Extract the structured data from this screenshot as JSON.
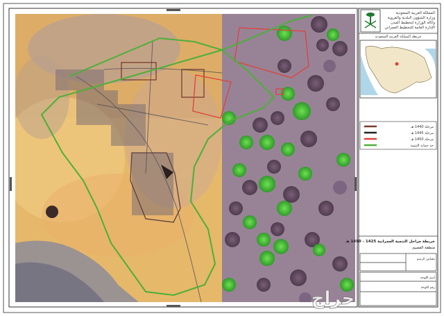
{
  "sheet": {
    "title_block": {
      "emblem": "saudi-emblem",
      "org_lines": [
        "المملكة العربية السعودية",
        "وزارة الشؤون البلدية والقروية",
        "وكالة الوزارة لتخطيط المدن",
        "الإدارة العامة للتخطيط العمراني"
      ],
      "inset_caption": "خريطة المملكة العربية السعودية",
      "map_title": "خريطة مراحل التنمية العمرانية 1425 - 1450 هـ",
      "map_subtitle": "منطقة القصيم",
      "footer_labels": [
        "مقياس الرسم",
        "اسم اللوحة",
        "رقم اللوحة"
      ]
    },
    "legend": [
      {
        "label": "مرحلة 1440 هـ",
        "color": "#7a3b2e"
      },
      {
        "label": "مرحلة 1445 هـ",
        "color": "#222222"
      },
      {
        "label": "مرحلة 1450 هـ",
        "color": "#e0403a"
      },
      {
        "label": "حد حماية التنمية",
        "color": "#4caf3a"
      }
    ],
    "watermark": "حراج"
  }
}
